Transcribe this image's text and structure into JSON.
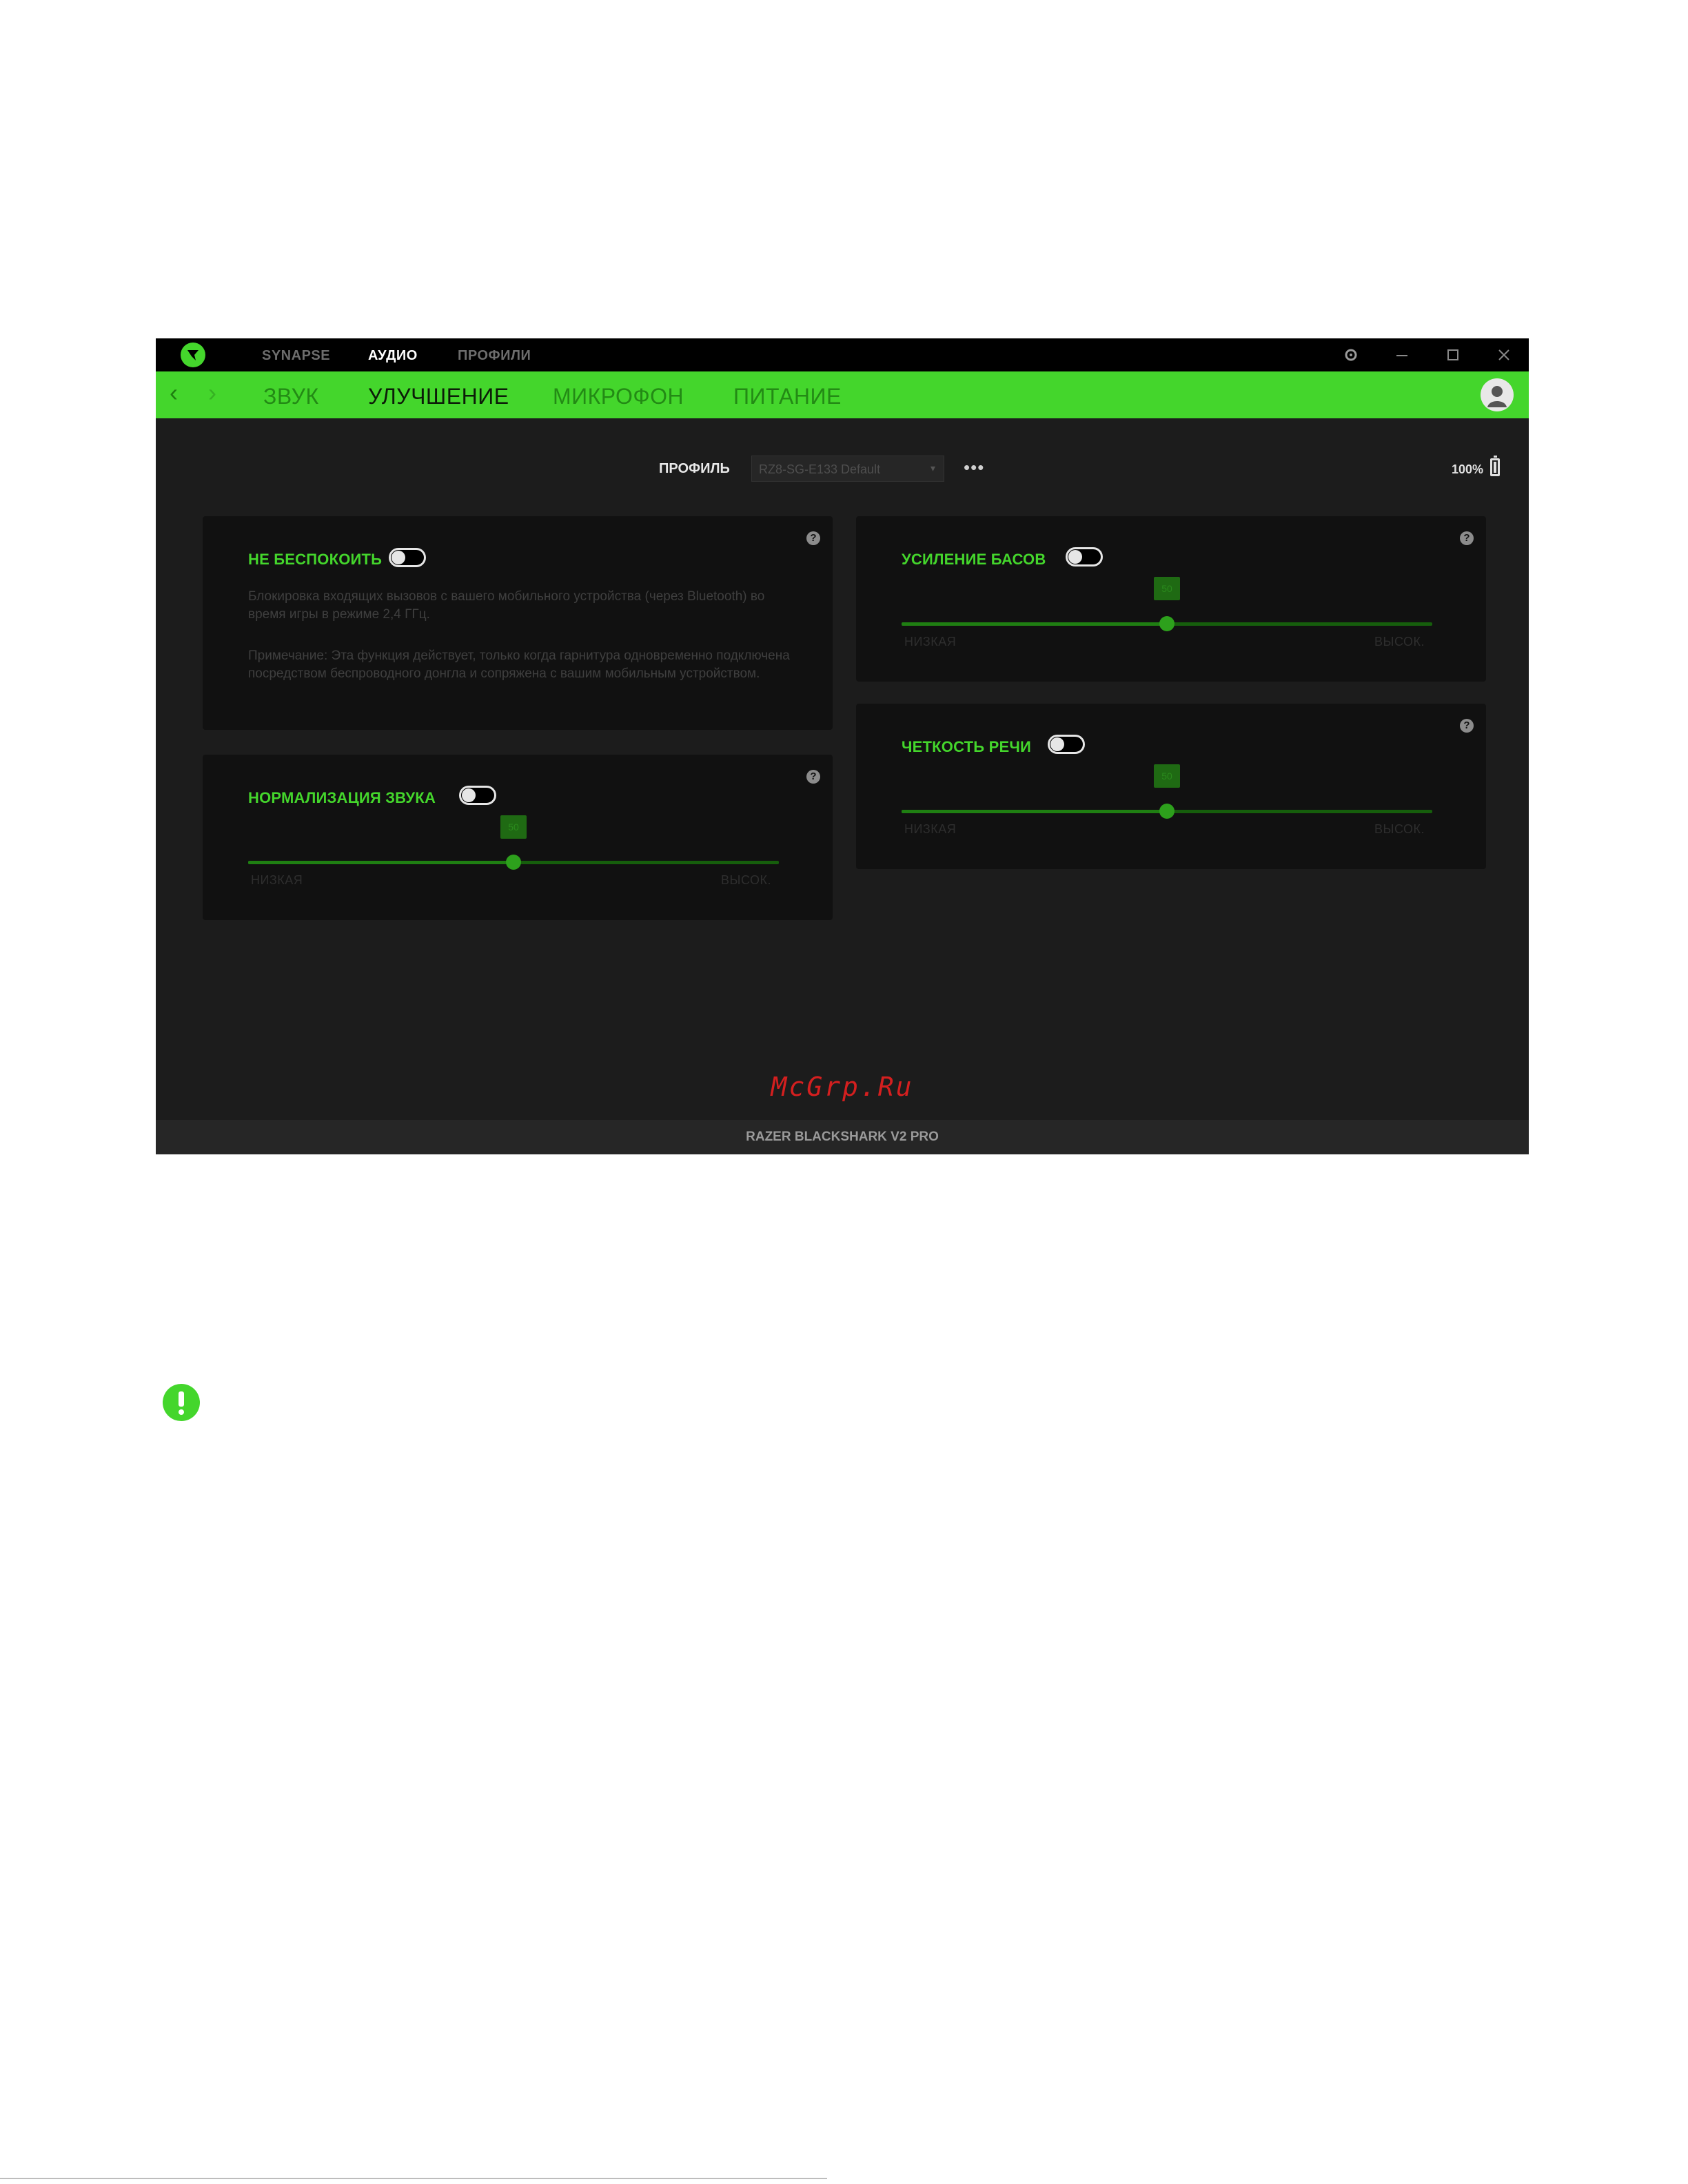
{
  "titlebar": {
    "tabs": [
      {
        "label": "SYNAPSE"
      },
      {
        "label": "АУДИО"
      },
      {
        "label": "ПРОФИЛИ"
      }
    ],
    "active_tab": "АУДИО"
  },
  "navbar": {
    "tabs": [
      {
        "label": "ЗВУК"
      },
      {
        "label": "УЛУЧШЕНИЕ"
      },
      {
        "label": "МИКРОФОН"
      },
      {
        "label": "ПИТАНИЕ"
      }
    ],
    "active_tab": "УЛУЧШЕНИЕ"
  },
  "profile": {
    "label": "ПРОФИЛЬ",
    "selected": "RZ8-SG-E133 Default",
    "more": "•••"
  },
  "battery": {
    "percent": "100%"
  },
  "cards": {
    "dnd": {
      "title": "НЕ БЕСПОКОИТЬ",
      "enabled": false,
      "description": "Блокировка входящих вызовов с вашего мобильного устройства (через Bluetooth) во время игры в режиме 2,4 ГГц.",
      "note": "Примечание: Эта функция действует, только когда гарнитура одновременно подключена посредством беспроводного донгла и сопряжена с вашим мобильным устройством."
    },
    "normalization": {
      "title": "НОРМАЛИЗАЦИЯ ЗВУКА",
      "enabled": false,
      "level": 0.5,
      "value_label": "50",
      "low_label": "НИЗКАЯ",
      "high_label": "ВЫСОК."
    },
    "bass": {
      "title": "УСИЛЕНИЕ БАСОВ",
      "enabled": false,
      "level": 0.5,
      "value_label": "50",
      "low_label": "НИЗКАЯ",
      "high_label": "ВЫСОК."
    },
    "clarity": {
      "title": "ЧЕТКОСТЬ РЕЧИ",
      "enabled": false,
      "level": 0.5,
      "value_label": "50",
      "low_label": "НИЗКАЯ",
      "high_label": "ВЫСОК."
    }
  },
  "footer": {
    "device": "RAZER BLACKSHARK V2 PRO"
  },
  "watermark": "McGrp.Ru",
  "colors": {
    "accent": "#44d62c",
    "background": "#1c1c1c",
    "card": "#111111"
  },
  "icons": [
    "razer-logo-icon",
    "gear-icon",
    "minimize-icon",
    "maximize-icon",
    "close-icon",
    "back-icon",
    "forward-icon",
    "user-icon",
    "help-icon",
    "battery-icon",
    "alert-icon"
  ]
}
